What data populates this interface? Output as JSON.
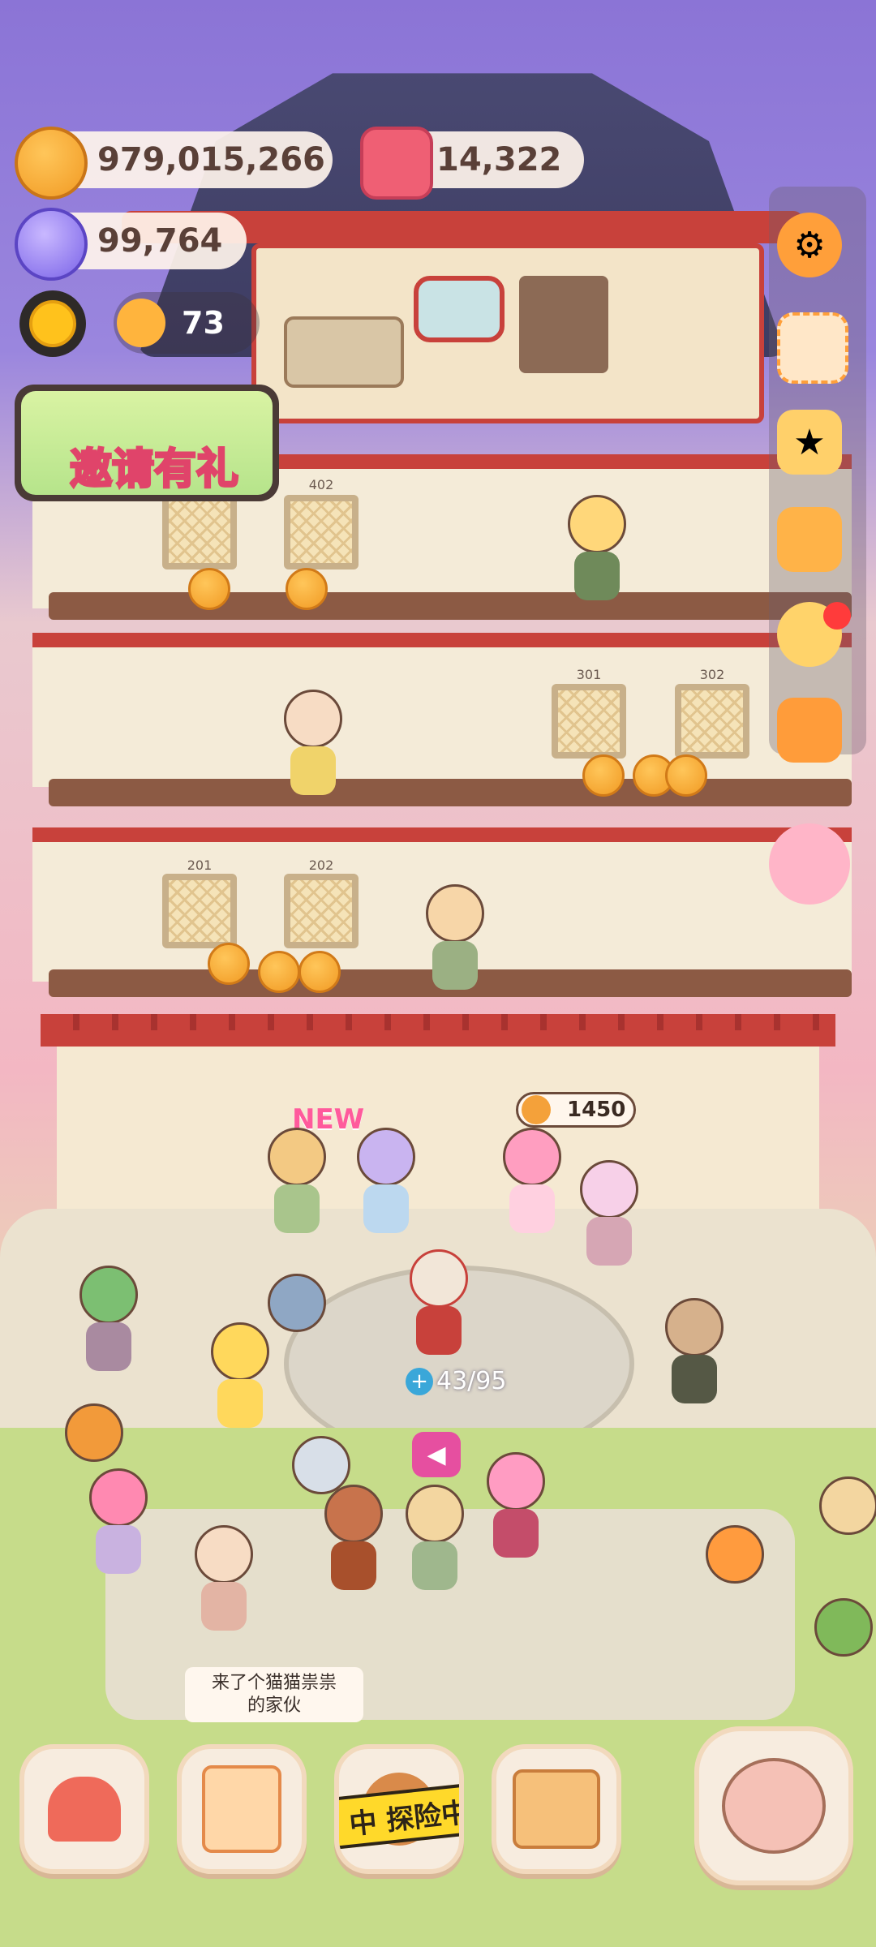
{
  "currency": {
    "coins": "979,015,266",
    "gems": "14,322",
    "crystals": "99,764",
    "sun_level_count": "73"
  },
  "invite_banner": {
    "label": "邀请有礼"
  },
  "rooms": {
    "floor4": [
      "402"
    ],
    "floor3": [
      "301",
      "302"
    ],
    "floor2": [
      "201",
      "202"
    ]
  },
  "hall": {
    "new_badge": "NEW",
    "price_tag": "1450",
    "capacity": "43/95"
  },
  "notice": {
    "line1": "来了个猫猫祟祟",
    "line2": "的家伙"
  },
  "dock": {
    "explore_label": "中 探险中"
  },
  "colors": {
    "roof": "#3d3c62",
    "trim_red": "#c8413b",
    "coin": "#f19a23",
    "gem": "#ef5f74",
    "crystal": "#8f7af0",
    "explore_tape": "#ffd92a"
  },
  "icons": [
    "coin-icon",
    "gem-icon",
    "crystal-icon",
    "sun-icon",
    "settings-icon",
    "stamp-icon",
    "star-icon",
    "backpack-icon",
    "friends-icon",
    "camera-icon",
    "lollipop-icon",
    "mushroom-house-icon",
    "notebook-icon",
    "map-icon",
    "shop-icon",
    "fish-snail-icon",
    "megaphone-icon"
  ]
}
